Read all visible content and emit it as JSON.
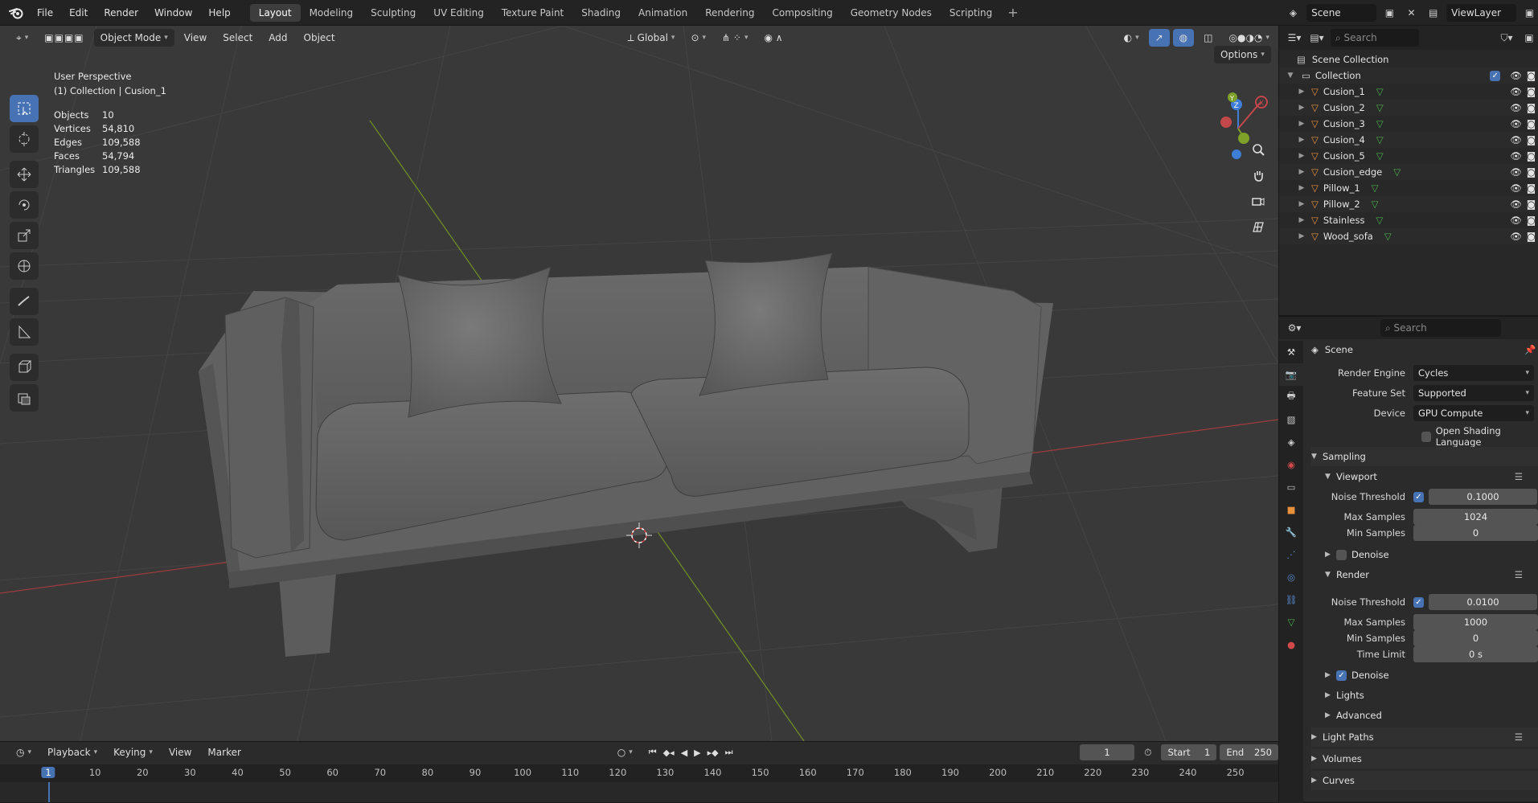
{
  "menubar": {
    "items": [
      "File",
      "Edit",
      "Render",
      "Window",
      "Help"
    ],
    "workspaces": [
      "Layout",
      "Modeling",
      "Sculpting",
      "UV Editing",
      "Texture Paint",
      "Shading",
      "Animation",
      "Rendering",
      "Compositing",
      "Geometry Nodes",
      "Scripting"
    ],
    "active_workspace": "Layout",
    "add_label": "+"
  },
  "scenebar": {
    "scene": "Scene",
    "view_layer": "ViewLayer"
  },
  "viewport": {
    "mode": "Object Mode",
    "menus": [
      "View",
      "Select",
      "Add",
      "Object"
    ],
    "transform_orientation": "Global",
    "options_label": "Options",
    "perspective_label": "User Perspective",
    "collection_label": "(1) Collection | Cusion_1",
    "stats": [
      {
        "key": "Objects",
        "value": "10"
      },
      {
        "key": "Vertices",
        "value": "54,810"
      },
      {
        "key": "Edges",
        "value": "109,588"
      },
      {
        "key": "Faces",
        "value": "54,794"
      },
      {
        "key": "Triangles",
        "value": "109,588"
      }
    ],
    "gizmo": {
      "z": "Z",
      "y": "Y",
      "x": "X"
    },
    "colors": {
      "x_axis": "#c2474b",
      "y_axis": "#7fa12a",
      "z_axis": "#3f7ed6",
      "active_tool": "#4772b3"
    }
  },
  "outliner": {
    "search_placeholder": "Search",
    "scene_collection": "Scene Collection",
    "collection": "Collection",
    "objects": [
      "Cusion_1",
      "Cusion_2",
      "Cusion_3",
      "Cusion_4",
      "Cusion_5",
      "Cusion_edge",
      "Pillow_1",
      "Pillow_2",
      "Stainless",
      "Wood_sofa"
    ]
  },
  "properties": {
    "search_placeholder": "Search",
    "context": "Scene",
    "render_engine": {
      "label": "Render Engine",
      "value": "Cycles"
    },
    "feature_set": {
      "label": "Feature Set",
      "value": "Supported"
    },
    "device": {
      "label": "Device",
      "value": "GPU Compute"
    },
    "osl": "Open Shading Language",
    "sampling": "Sampling",
    "viewport_panel": "Viewport",
    "render_panel": "Render",
    "noise_threshold_label": "Noise Threshold",
    "max_samples_label": "Max Samples",
    "min_samples_label": "Min Samples",
    "time_limit_label": "Time Limit",
    "viewport_noise": "0.1000",
    "viewport_max": "1024",
    "viewport_min": "0",
    "denoise_label": "Denoise",
    "render_noise": "0.0100",
    "render_max": "1000",
    "render_min": "0",
    "time_limit": "0 s",
    "lights": "Lights",
    "advanced": "Advanced",
    "light_paths": "Light Paths",
    "volumes": "Volumes",
    "curves": "Curves"
  },
  "timeline": {
    "menus": [
      "Playback",
      "Keying",
      "View",
      "Marker"
    ],
    "current_frame": "1",
    "start_label": "Start",
    "start": "1",
    "end_label": "End",
    "end": "250",
    "ticks": [
      "1",
      "10",
      "20",
      "30",
      "40",
      "50",
      "60",
      "70",
      "80",
      "90",
      "100",
      "110",
      "120",
      "130",
      "140",
      "150",
      "160",
      "170",
      "180",
      "190",
      "200",
      "210",
      "220",
      "230",
      "240",
      "250"
    ]
  }
}
